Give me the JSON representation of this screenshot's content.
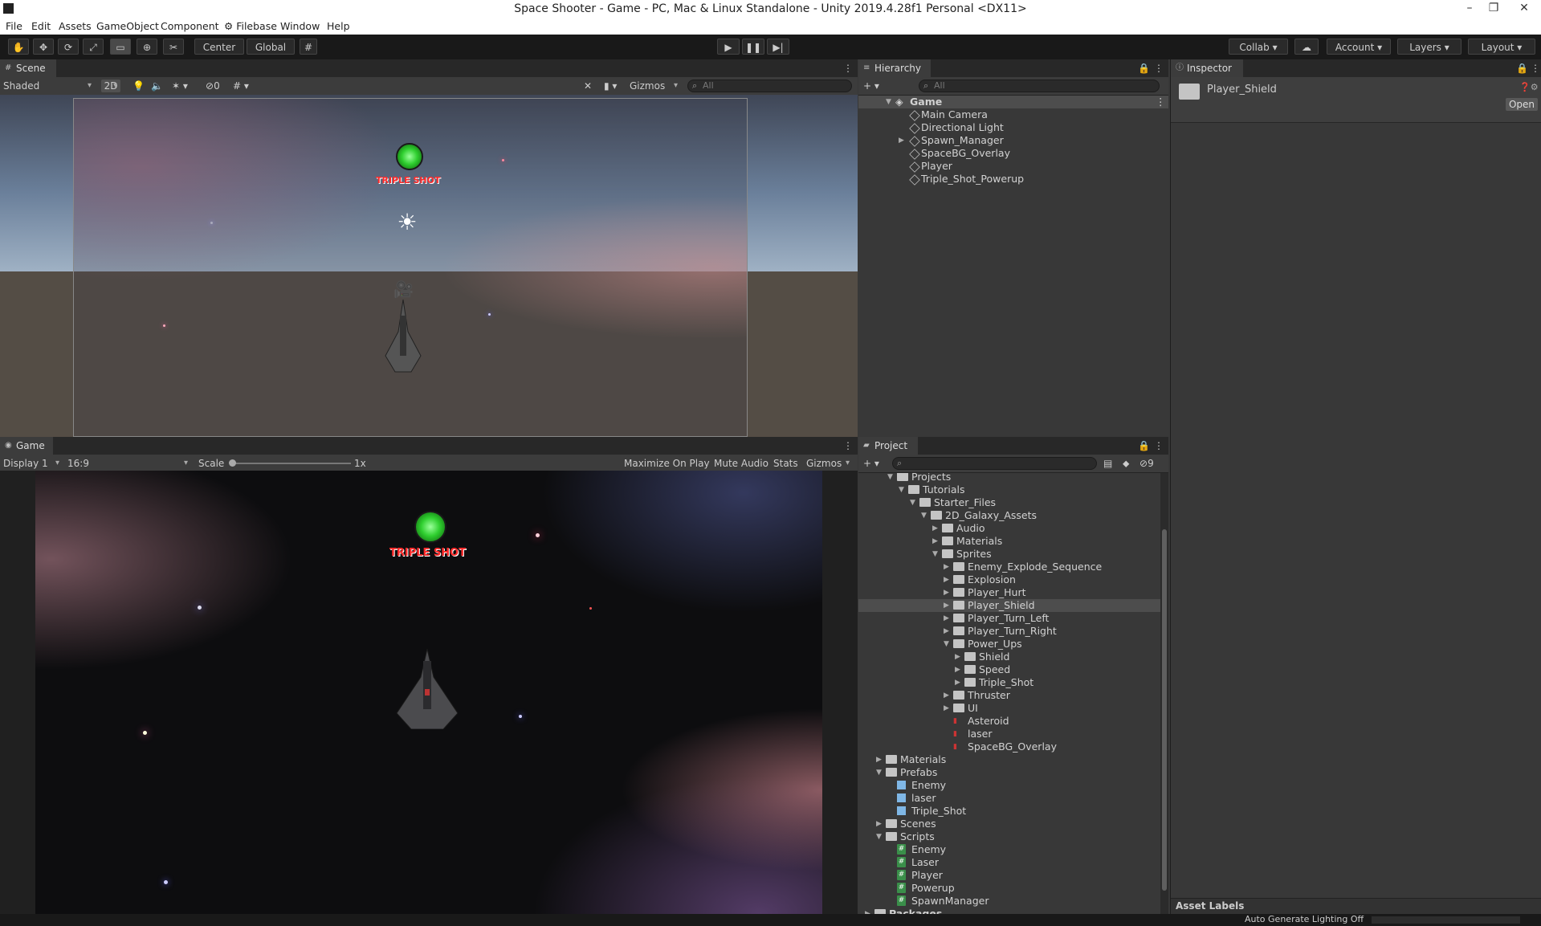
{
  "window": {
    "title": "Space Shooter - Game - PC, Mac & Linux Standalone - Unity 2019.4.28f1 Personal <DX11>"
  },
  "menu": [
    "File",
    "Edit",
    "Assets",
    "GameObject",
    "Component",
    "Filebase",
    "Window",
    "Help"
  ],
  "toolbar": {
    "pivot": "Center",
    "space": "Global",
    "collab": "Collab",
    "account": "Account",
    "layers": "Layers",
    "layout": "Layout"
  },
  "scene": {
    "tab": "Scene",
    "shading": "Shaded",
    "mode2d": "2D",
    "fx_count": "0",
    "gizmos": "Gizmos",
    "search_placeholder": "All"
  },
  "game": {
    "tab": "Game",
    "display": "Display 1",
    "aspect": "16:9",
    "scale_label": "Scale",
    "scale_value": "1x",
    "maximize": "Maximize On Play",
    "mute": "Mute Audio",
    "stats": "Stats",
    "gizmos": "Gizmos",
    "powerup_text": "TRIPLE SHOT"
  },
  "hierarchy": {
    "tab": "Hierarchy",
    "search_placeholder": "All",
    "scene_name": "Game",
    "items": [
      "Main Camera",
      "Directional Light",
      "Spawn_Manager",
      "SpaceBG_Overlay",
      "Player",
      "Triple_Shot_Powerup"
    ]
  },
  "inspector": {
    "tab": "Inspector",
    "selected": "Player_Shield",
    "open_button": "Open",
    "asset_labels": "Asset Labels"
  },
  "project": {
    "tab": "Project",
    "hidden_count": "9",
    "tree": [
      {
        "label": "Projects",
        "depth": 2,
        "type": "folder",
        "expanded": true
      },
      {
        "label": "Tutorials",
        "depth": 3,
        "type": "folder",
        "expanded": true
      },
      {
        "label": "Starter_Files",
        "depth": 4,
        "type": "folder",
        "expanded": true
      },
      {
        "label": "2D_Galaxy_Assets",
        "depth": 5,
        "type": "folder",
        "expanded": true
      },
      {
        "label": "Audio",
        "depth": 6,
        "type": "folder"
      },
      {
        "label": "Materials",
        "depth": 6,
        "type": "folder"
      },
      {
        "label": "Sprites",
        "depth": 6,
        "type": "folder",
        "expanded": true
      },
      {
        "label": "Enemy_Explode_Sequence",
        "depth": 7,
        "type": "folder"
      },
      {
        "label": "Explosion",
        "depth": 7,
        "type": "folder"
      },
      {
        "label": "Player_Hurt",
        "depth": 7,
        "type": "folder"
      },
      {
        "label": "Player_Shield",
        "depth": 7,
        "type": "folder",
        "selected": true
      },
      {
        "label": "Player_Turn_Left",
        "depth": 7,
        "type": "folder"
      },
      {
        "label": "Player_Turn_Right",
        "depth": 7,
        "type": "folder"
      },
      {
        "label": "Power_Ups",
        "depth": 7,
        "type": "folder",
        "expanded": true
      },
      {
        "label": "Shield",
        "depth": 8,
        "type": "folder"
      },
      {
        "label": "Speed",
        "depth": 8,
        "type": "folder"
      },
      {
        "label": "Triple_Shot",
        "depth": 8,
        "type": "folder"
      },
      {
        "label": "Thruster",
        "depth": 7,
        "type": "folder"
      },
      {
        "label": "UI",
        "depth": 7,
        "type": "folder"
      },
      {
        "label": "Asteroid",
        "depth": 7,
        "type": "sprite"
      },
      {
        "label": "laser",
        "depth": 7,
        "type": "sprite"
      },
      {
        "label": "SpaceBG_Overlay",
        "depth": 7,
        "type": "sprite"
      },
      {
        "label": "Materials",
        "depth": 1,
        "type": "folder"
      },
      {
        "label": "Prefabs",
        "depth": 1,
        "type": "folder",
        "expanded": true
      },
      {
        "label": "Enemy",
        "depth": 2,
        "type": "prefab"
      },
      {
        "label": "laser",
        "depth": 2,
        "type": "prefab"
      },
      {
        "label": "Triple_Shot",
        "depth": 2,
        "type": "prefab"
      },
      {
        "label": "Scenes",
        "depth": 1,
        "type": "folder"
      },
      {
        "label": "Scripts",
        "depth": 1,
        "type": "folder",
        "expanded": true
      },
      {
        "label": "Enemy",
        "depth": 2,
        "type": "script"
      },
      {
        "label": "Laser",
        "depth": 2,
        "type": "script"
      },
      {
        "label": "Player",
        "depth": 2,
        "type": "script"
      },
      {
        "label": "Powerup",
        "depth": 2,
        "type": "script"
      },
      {
        "label": "SpawnManager",
        "depth": 2,
        "type": "script"
      },
      {
        "label": "Packages",
        "depth": 0,
        "type": "folder"
      }
    ]
  },
  "status": {
    "lighting": "Auto Generate Lighting Off"
  },
  "colors": {
    "editor_bg": "#383838",
    "selection": "#4d4d4d",
    "powerup_green": "#2fcf2f",
    "triple_red": "#ff2a2a"
  }
}
